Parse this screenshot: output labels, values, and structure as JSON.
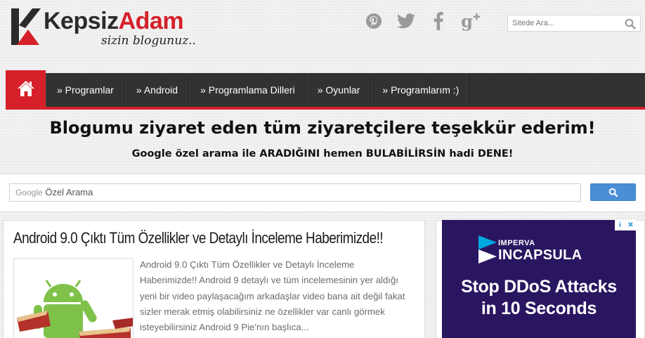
{
  "header": {
    "logo_word1": "Kepsiz",
    "logo_word2": "Adam",
    "tagline": "sizin blogunuz..",
    "social": [
      {
        "name": "pinterest-icon",
        "glyph": "P"
      },
      {
        "name": "twitter-icon",
        "glyph": "t"
      },
      {
        "name": "facebook-icon",
        "glyph": "f"
      },
      {
        "name": "google-plus-icon",
        "glyph": "g+"
      }
    ],
    "search_placeholder": "Sitede Ara..."
  },
  "nav": {
    "home_icon": "home-icon",
    "items": [
      "» Programlar",
      "» Android",
      "» Programlama Dilleri",
      "» Oyunlar",
      "» Programlarım :)"
    ]
  },
  "banner": {
    "title": "Blogumu ziyaret eden tüm ziyaretçilere teşekkür ederim!",
    "subtitle": "Google özel arama ile ARADIĞINI hemen BULABİLİRSİN hadi DENE!"
  },
  "google_search": {
    "brand": "Google",
    "placeholder": "Özel Arama",
    "button_icon": "search-icon"
  },
  "post": {
    "title": "Android 9.0 Çıktı Tüm Özellikler ve Detaylı İnceleme Haberimizde!!",
    "excerpt_lines": [
      "Android 9.0 Çıktı Tüm  Özellikler ve Detaylı İnceleme",
      "Haberimizde!! Android 9 detaylı ve tüm incelemesinin yer aldığı",
      "yeni bir video paylaşacağım arkadaşlar video bana ait değil fakat",
      "sizler merak etmiş olabilirsiniz ne özellikler var canlı görmek",
      "isteyebilirsiniz Android 9 Pie'nın başlıca..."
    ]
  },
  "ad": {
    "brand_small": "IMPERVA",
    "brand_large": "INCAPSULA",
    "headline_1": "Stop DDoS Attacks",
    "headline_2": "in 10 Seconds",
    "info_glyph": "i",
    "close_glyph": "✕",
    "colors": {
      "background": "#2a1660",
      "accent": "#00a8e1"
    }
  },
  "colors": {
    "brand_red": "#d6202a",
    "nav_dark": "#323232",
    "google_blue": "#4a8ed8"
  }
}
